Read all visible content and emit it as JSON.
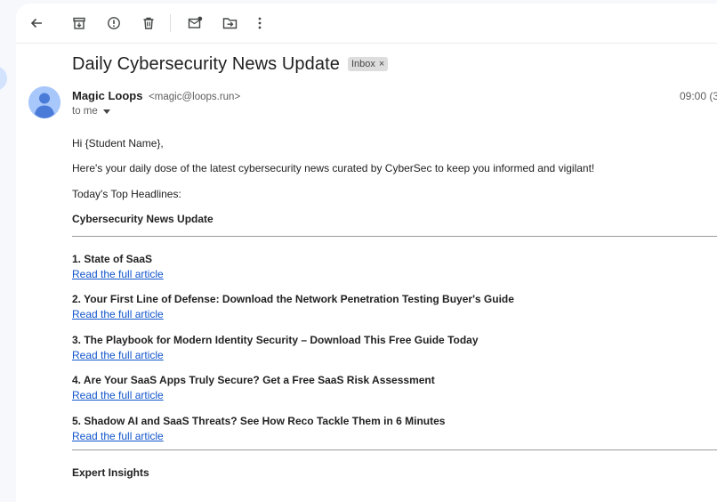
{
  "toolbar": {
    "icons": [
      "back-arrow-icon",
      "archive-icon",
      "report-spam-icon",
      "delete-icon",
      "mark-unread-icon",
      "move-to-icon",
      "more-vert-icon"
    ]
  },
  "email": {
    "subject": "Daily Cybersecurity News Update",
    "label": "Inbox",
    "label_remove": "×",
    "sender_name": "Magic Loops",
    "sender_email": "<magic@loops.run>",
    "time": "09:00 (3",
    "to": "to me"
  },
  "body": {
    "greeting": "Hi {Student Name},",
    "intro": "Here's your daily dose of the latest cybersecurity news curated by CyberSec to keep you informed and vigilant!",
    "headlines_label": "Today's Top Headlines:",
    "section_title": "Cybersecurity News Update",
    "articles": [
      {
        "title": "1. State of SaaS",
        "link": "Read the full article"
      },
      {
        "title": "2. Your First Line of Defense: Download the Network Penetration Testing Buyer's Guide",
        "link": "Read the full article"
      },
      {
        "title": "3. The Playbook for Modern Identity Security – Download This Free Guide Today",
        "link": "Read the full article"
      },
      {
        "title": "4. Are Your SaaS Apps Truly Secure? Get a Free SaaS Risk Assessment",
        "link": "Read the full article"
      },
      {
        "title": "5. Shadow AI and SaaS Threats? See How Reco Tackle Them in 6 Minutes",
        "link": "Read the full article"
      }
    ],
    "expert_title": "Expert Insights"
  },
  "colors": {
    "background": "#f6f8fc",
    "pane": "#ffffff",
    "link": "#1155cc",
    "chip": "#dddddd"
  }
}
